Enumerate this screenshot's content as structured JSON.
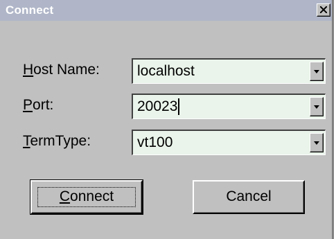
{
  "dialog": {
    "title": "Connect",
    "close_icon": "close-icon"
  },
  "fields": {
    "host": {
      "label_mnemonic": "H",
      "label_rest": "ost Name:",
      "value": "localhost"
    },
    "port": {
      "label_mnemonic": "P",
      "label_rest": "ort:",
      "value": "20023"
    },
    "termtype": {
      "label_mnemonic": "T",
      "label_rest": "ermType:",
      "value": "vt100"
    }
  },
  "buttons": {
    "connect": {
      "mnemonic": "C",
      "rest": "onnect"
    },
    "cancel": {
      "label": "Cancel"
    }
  },
  "colors": {
    "titlebar": "#b0b6c8",
    "face": "#c0c0c0",
    "field_background": "#eaf4ea"
  }
}
